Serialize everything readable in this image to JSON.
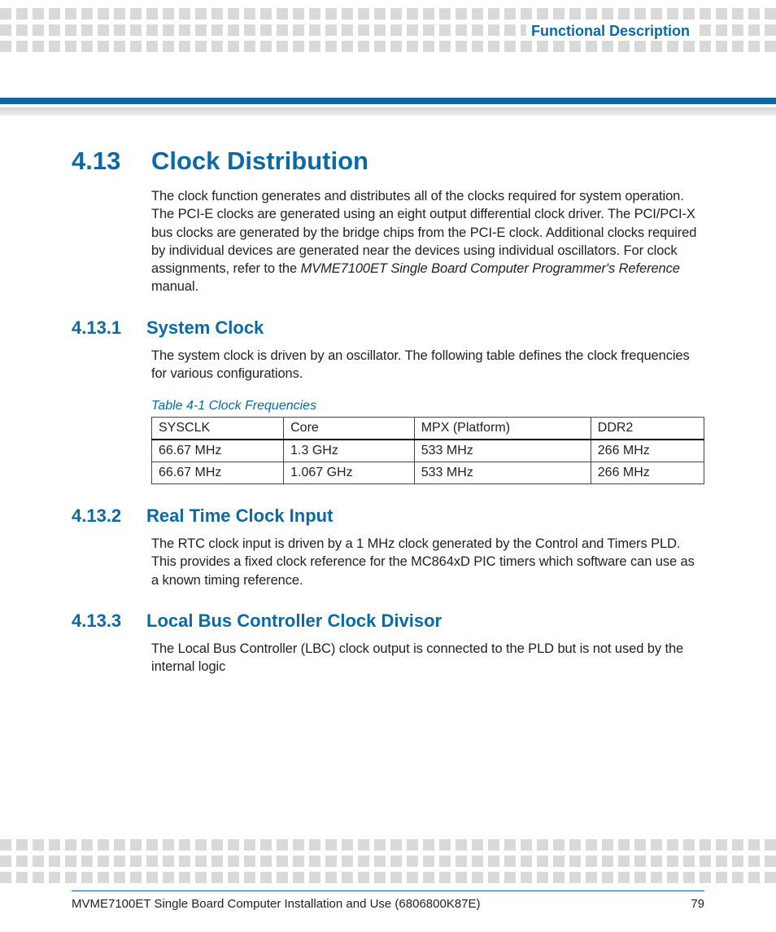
{
  "header": {
    "label": "Functional Description"
  },
  "section": {
    "number": "4.13",
    "title": "Clock Distribution",
    "intro_a": "The clock function generates and distributes all of the clocks required for system operation. The PCI-E clocks are generated using an eight output differential clock driver. The PCI/PCI-X bus clocks are generated by the bridge chips from the PCI-E clock. Additional clocks required by individual devices are generated near the devices using individual oscillators. For clock assignments, refer to the ",
    "intro_ref": "MVME7100ET Single Board Computer Programmer's Reference",
    "intro_b": " manual."
  },
  "sub1": {
    "number": "4.13.1",
    "title": "System Clock",
    "body": "The system clock is driven by an oscillator. The following table defines the clock frequencies for various configurations."
  },
  "table": {
    "caption": "Table 4-1 Clock Frequencies",
    "headers": [
      "SYSCLK",
      "Core",
      "MPX (Platform)",
      "DDR2"
    ],
    "rows": [
      [
        "66.67 MHz",
        "1.3 GHz",
        "533 MHz",
        "266 MHz"
      ],
      [
        "66.67 MHz",
        "1.067 GHz",
        "533 MHz",
        "266 MHz"
      ]
    ]
  },
  "sub2": {
    "number": "4.13.2",
    "title": "Real Time Clock Input",
    "body": "The RTC clock input is driven by a 1 MHz clock generated by the Control and Timers PLD. This provides a fixed clock reference for the MC864xD PIC timers which software can use as a known timing reference."
  },
  "sub3": {
    "number": "4.13.3",
    "title": "Local Bus Controller Clock Divisor",
    "body": "The Local Bus Controller (LBC) clock output is connected to the PLD but is not used by the internal logic"
  },
  "footer": {
    "left": "MVME7100ET Single Board Computer Installation and Use (6806800K87E)",
    "page": "79"
  }
}
